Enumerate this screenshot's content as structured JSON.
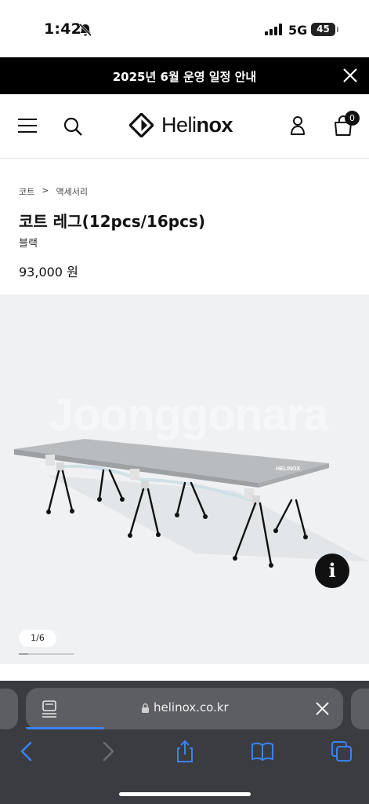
{
  "status_bar": {
    "time": "1:42",
    "network": "5G",
    "battery": "45"
  },
  "announcement": {
    "text": "2025년 6월 운영 일정 안내"
  },
  "header": {
    "logo_prefix": "Heli",
    "logo_suffix": "nox",
    "cart_count": "0"
  },
  "breadcrumb": {
    "level1": "코트",
    "separator": ">",
    "level2": "액세서리"
  },
  "product": {
    "title": "코트 레그(12pcs/16pcs)",
    "color": "블랙",
    "price": "93,000 원"
  },
  "gallery": {
    "watermark": "Joonggonara",
    "counter": "1/6",
    "image_count": 6,
    "current_index": 1,
    "info_label": "i"
  },
  "browser": {
    "url": "helinox.co.kr"
  },
  "colors": {
    "accent_blue": "#3b82f6",
    "toolbar_bg": "#3b3c40",
    "announce_bg": "#000000"
  }
}
